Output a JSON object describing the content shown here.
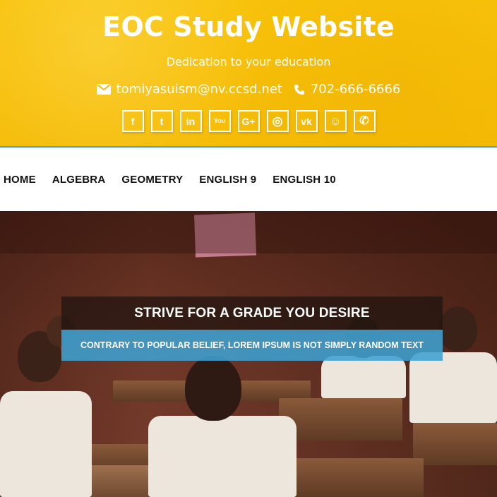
{
  "header": {
    "title": "EOC Study Website",
    "tagline": "Dedication to your education",
    "email": "tomiyasuism@nv.ccsd.net",
    "phone": "702-666-6666",
    "socials": [
      {
        "icon": "facebook-icon",
        "glyph": "f"
      },
      {
        "icon": "twitter-icon",
        "glyph": "t"
      },
      {
        "icon": "linkedin-icon",
        "glyph": "in"
      },
      {
        "icon": "youtube-icon",
        "glyph": "You"
      },
      {
        "icon": "google-plus-icon",
        "glyph": "G+"
      },
      {
        "icon": "instagram-icon",
        "glyph": "◎"
      },
      {
        "icon": "vk-icon",
        "glyph": "vk"
      },
      {
        "icon": "snapchat-icon",
        "glyph": "☺"
      },
      {
        "icon": "whatsapp-icon",
        "glyph": "✆"
      }
    ]
  },
  "nav": {
    "items": [
      "HOME",
      "ALGEBRA",
      "GEOMETRY",
      "ENGLISH 9",
      "ENGLISH 10"
    ]
  },
  "hero": {
    "heading": "STRIVE FOR A GRADE YOU DESIRE",
    "subheading": "CONTRARY TO POPULAR BELIEF, LOREM IPSUM IS NOT SIMPLY RANDOM TEXT"
  },
  "colors": {
    "header_bg": "#f8c20a",
    "accent_blue": "#3ea0d2",
    "banner_dark": "#1e140f"
  }
}
